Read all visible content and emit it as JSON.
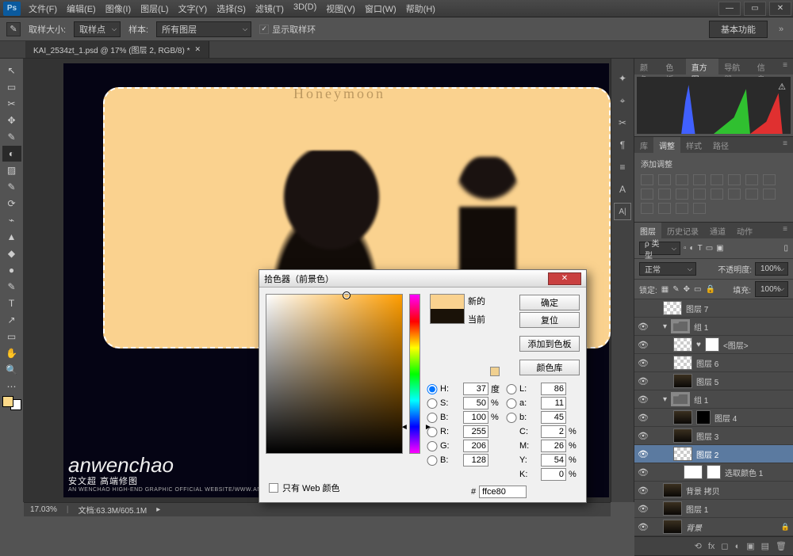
{
  "menu": [
    "文件(F)",
    "编辑(E)",
    "图像(I)",
    "图层(L)",
    "文字(Y)",
    "选择(S)",
    "滤镜(T)",
    "3D(D)",
    "视图(V)",
    "窗口(W)",
    "帮助(H)"
  ],
  "optbar": {
    "lbl_size": "取样大小:",
    "size_val": "取样点",
    "lbl_sample": "样本:",
    "sample_val": "所有图层",
    "chk_ring": "显示取样环",
    "btn_basic": "基本功能"
  },
  "doc_tab": "KAI_2534zt_1.psd @ 17% (图层 2, RGB/8) *",
  "status": {
    "zoom": "17.03%",
    "docinfo": "文档:63.3M/605.1M"
  },
  "watermark": {
    "script": "anwenchao",
    "cn": "安文超 高端修图",
    "sub": "AN WENCHAO HIGH-END GRAPHIC OFFICIAL WEBSITE/WWW.ANWENCHAO.COM"
  },
  "canvas_text": "Honeymoon",
  "panel_tabs": {
    "row1": [
      "颜色",
      "色板",
      "直方图",
      "导航器",
      "信息"
    ],
    "row2": [
      "库",
      "调整",
      "样式",
      "路径"
    ],
    "row3": [
      "图层",
      "历史记录",
      "通道",
      "动作"
    ]
  },
  "adjust": {
    "title": "添加调整"
  },
  "layers_top": {
    "kind": "ρ 类型",
    "blend": "正常",
    "opacity_lbl": "不透明度:",
    "opacity_val": "100%",
    "lock_lbl": "锁定:",
    "fill_lbl": "填充:",
    "fill_val": "100%"
  },
  "layers": [
    {
      "vis": "",
      "t": "checker",
      "name": "图层 7",
      "ind": 1
    },
    {
      "vis": "●",
      "t": "folder",
      "name": "组 1",
      "ind": 1,
      "arrow": "▾",
      "group": true
    },
    {
      "vis": "●",
      "t": "checker",
      "name": "<图层>",
      "ind": 2,
      "mask": "white",
      "extra": "♥"
    },
    {
      "vis": "●",
      "t": "checker",
      "name": "图层 6",
      "ind": 2
    },
    {
      "vis": "●",
      "t": "img",
      "name": "图层 5",
      "ind": 2
    },
    {
      "vis": "●",
      "t": "folder",
      "name": "组 1",
      "ind": 1,
      "arrow": "▾",
      "group": true
    },
    {
      "vis": "●",
      "t": "img",
      "name": "图层 4",
      "ind": 2,
      "mask": "black"
    },
    {
      "vis": "●",
      "t": "img",
      "name": "图层 3",
      "ind": 2
    },
    {
      "vis": "●",
      "t": "checker",
      "name": "图层 2",
      "ind": 2,
      "sel": true
    },
    {
      "vis": "●",
      "t": "white",
      "name": "选取颜色 1",
      "ind": 3,
      "mask": "white",
      "adj": true
    },
    {
      "vis": "●",
      "t": "img",
      "name": "背景 拷贝",
      "ind": 1
    },
    {
      "vis": "●",
      "t": "img",
      "name": "图层 1",
      "ind": 1
    },
    {
      "vis": "●",
      "t": "img",
      "name": "背景",
      "ind": 1,
      "locked": true,
      "italic": true
    }
  ],
  "picker": {
    "title": "拾色器（前景色）",
    "new_lbl": "新的",
    "cur_lbl": "当前",
    "btn_ok": "确定",
    "btn_cancel": "复位",
    "btn_add": "添加到色板",
    "btn_lib": "颜色库",
    "webonly": "只有 Web 颜色",
    "H": "37",
    "S": "50",
    "Bv": "100",
    "R": "255",
    "G": "206",
    "Bc": "128",
    "L": "86",
    "a": "11",
    "b": "45",
    "C": "2",
    "M": "26",
    "Y": "54",
    "K": "0",
    "deg": "度",
    "pct": "%",
    "hex": "ffce80",
    "new_color": "#fad28f",
    "cur_color": "#1a1208"
  }
}
